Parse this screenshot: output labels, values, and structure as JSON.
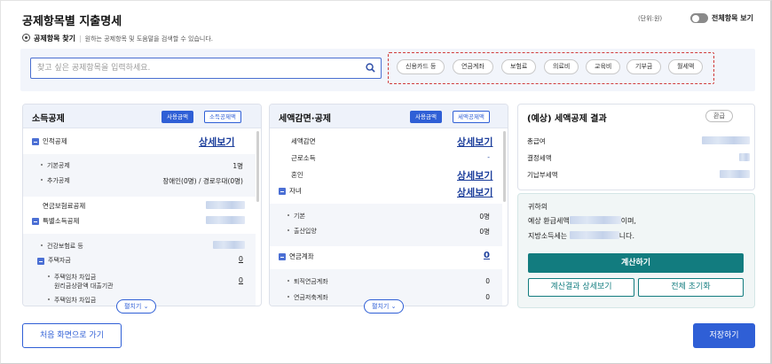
{
  "header": {
    "title": "공제항목별 지출명세",
    "unit": "(단위:원)",
    "toggle_label": "전체항목 보기"
  },
  "finder": {
    "label": "공제항목 찾기",
    "hint": "원하는 공제항목 및 도움말을 검색할 수 있습니다."
  },
  "search": {
    "placeholder": "찾고 싶은 공제항목을 입력하세요.",
    "value": ""
  },
  "chips": [
    "신용카드 등",
    "연금계좌",
    "보험료",
    "의료비",
    "교육비",
    "기부금",
    "월세액"
  ],
  "income": {
    "title": "소득공제",
    "btn_use": "사용금액",
    "btn_ded": "소득공제액",
    "personal": "인적공제",
    "detail": "상세보기",
    "basic": "기본공제",
    "basic_val": "1명",
    "extra": "추가공제",
    "extra_val": "장애인(0명) / 경로우대(0명)",
    "pension_ins": "연금보험료공제",
    "special": "특별소득공제",
    "health": "건강보험료 등",
    "housing": "주택자금",
    "housing_val": "0",
    "rent_loan_1": "주택임차 차입금",
    "rent_loan_2": "원리금상환액 대출기관",
    "rent_loan_val": "0",
    "rent_loan_3": "주택임차 차입금",
    "expand": "펼치기"
  },
  "credit": {
    "title": "세액감면·공제",
    "btn_use": "사용금액",
    "btn_ded": "세액공제액",
    "reduction": "세액감면",
    "detail1": "상세보기",
    "earned": "근로소득",
    "earned_val": "-",
    "marriage": "혼인",
    "detail2": "상세보기",
    "children": "자녀",
    "detail3": "상세보기",
    "child_basic": "기본",
    "child_basic_val": "0명",
    "birth": "출산입양",
    "birth_val": "0명",
    "pension_acct": "연금계좌",
    "pension_acct_val": "0",
    "retire": "퇴직연금계좌",
    "retire_val": "0",
    "savings": "연금저축계좌",
    "savings_val": "0",
    "expand": "펼치기"
  },
  "result": {
    "title": "(예상) 세액공제 결과",
    "badge": "환급",
    "gross": "총급여",
    "decided": "결정세액",
    "prepaid": "기납부세액"
  },
  "summary": {
    "line1": "귀하의",
    "line2a": "예상 환급세액",
    "line2b": "이며,",
    "line3a": "지방소득세는",
    "line3b": "니다."
  },
  "buttons": {
    "calc": "계산하기",
    "detail": "계산결과 상세보기",
    "reset": "전체 초기화",
    "back": "처음 화면으로 가기",
    "save": "저장하기"
  },
  "colors": {
    "primary": "#2f5fd6",
    "teal": "#127c7f",
    "highlight": "#d03a3a"
  }
}
